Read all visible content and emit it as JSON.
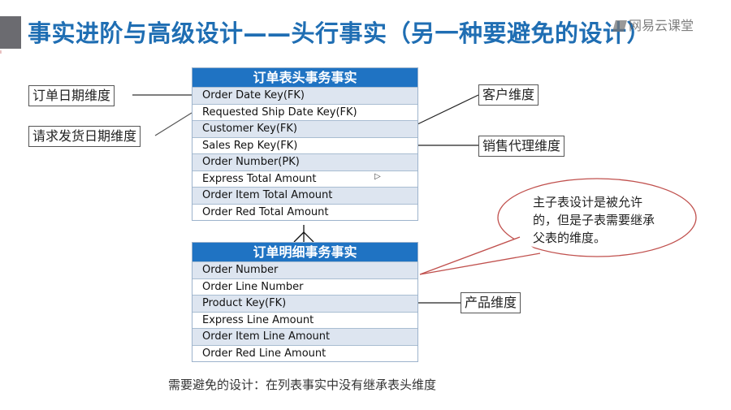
{
  "slide": {
    "title": "事实进阶与高级设计——头行事实（另一种要避免的设计）",
    "watermark": "网易云课堂",
    "footer_note": "需要避免的设计：在列表事实中没有继承表头维度"
  },
  "header_table": {
    "title": "订单表头事务事实",
    "rows": [
      "Order Date Key(FK)",
      "Requested Ship Date Key(FK)",
      "Customer Key(FK)",
      "Sales Rep Key(FK)",
      "Order Number(PK)",
      "Express Total Amount",
      "Order Item Total Amount",
      "Order Red Total Amount"
    ]
  },
  "line_table": {
    "title": "订单明细事务事实",
    "rows": [
      "Order Number",
      "Order Line Number",
      "Product Key(FK)",
      "Express Line Amount",
      "Order Item Line Amount",
      "Order Red Line Amount"
    ]
  },
  "dimensions": {
    "order_date": "订单日期维度",
    "request_ship_date": "请求发货日期维度",
    "customer": "客户维度",
    "sales_rep": "销售代理维度",
    "product": "产品维度"
  },
  "callout": {
    "text": "主子表设计是被允许的，但是子表需要继承父表的维度。"
  },
  "colors": {
    "title": "#1f6eb3",
    "table_header": "#1f73c3",
    "row_alt": "#dde5f0",
    "callout_border": "#c0504d"
  }
}
